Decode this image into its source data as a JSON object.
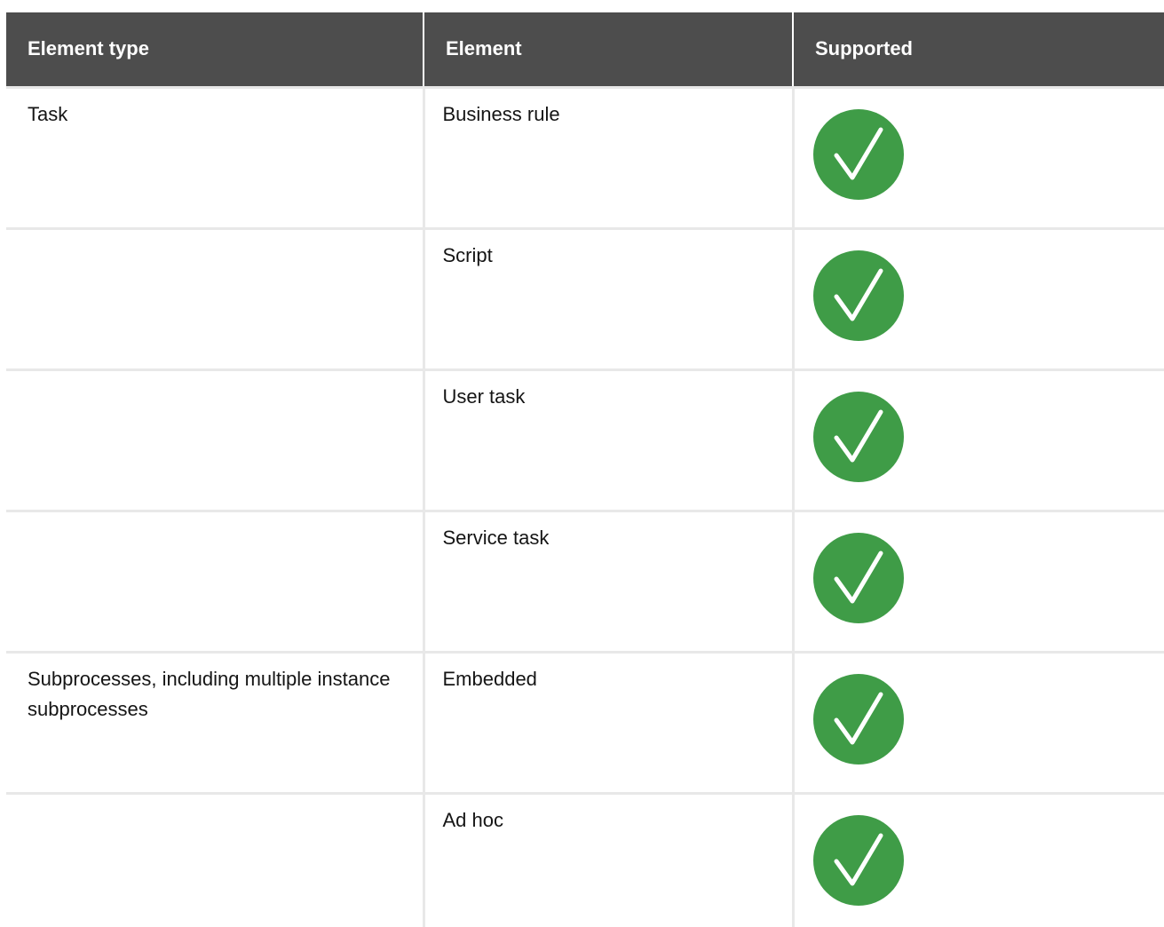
{
  "table": {
    "headers": [
      "Element type",
      "Element",
      "Supported"
    ],
    "rows": [
      {
        "element_type": "Task",
        "element": "Business rule",
        "supported_icon": "check-circle-icon"
      },
      {
        "element_type": "",
        "element": "Script",
        "supported_icon": "check-circle-icon"
      },
      {
        "element_type": "",
        "element": "User task",
        "supported_icon": "check-circle-icon"
      },
      {
        "element_type": "",
        "element": "Service task",
        "supported_icon": "check-circle-icon"
      },
      {
        "element_type": "Subprocesses, including multiple instance subprocesses",
        "element": "Embedded",
        "supported_icon": "check-circle-icon"
      },
      {
        "element_type": "",
        "element": "Ad hoc",
        "supported_icon": "check-circle-icon"
      }
    ]
  },
  "colors": {
    "header_bg": "#4d4d4d",
    "check_green": "#3f9c47",
    "grid_line": "#e8e8e8"
  }
}
